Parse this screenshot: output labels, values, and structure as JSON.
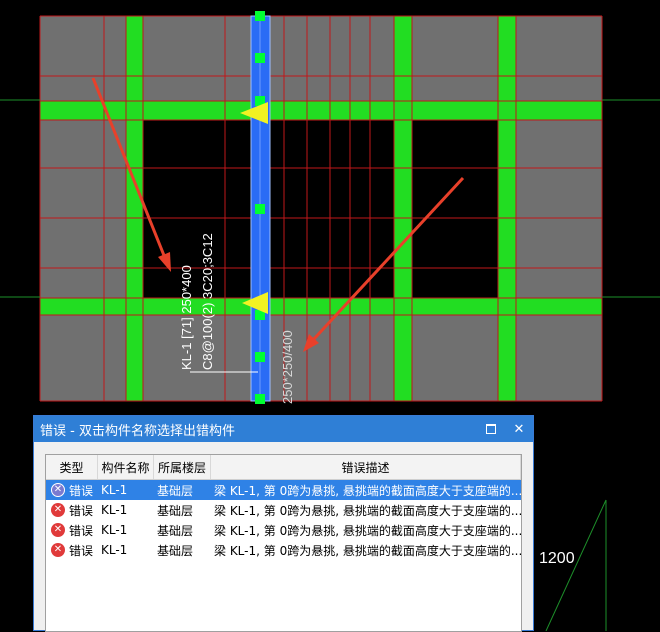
{
  "cad": {
    "beam_label_1": "KL-1 [71] 250*400",
    "beam_label_2": "C8@100(2) 3C20;3C12",
    "beam_label_3": "250*250/400",
    "dimension": "1200",
    "colors": {
      "slab": "#707070",
      "column": "#22dd22",
      "beam": "#2a6cf5",
      "grid": "#c0171a",
      "arrow": "#e8402a",
      "marker": "#f2f222"
    }
  },
  "dialog": {
    "title": "错误 - 双击构件名称选择出错构件",
    "columns": [
      "类型",
      "构件名称",
      "所属楼层",
      "错误描述"
    ],
    "rows": [
      {
        "type": "错误",
        "name": "KL-1",
        "floor": "基础层",
        "desc": "梁 KL-1, 第 0跨为悬挑, 悬挑端的截面高度大于支座端的..."
      },
      {
        "type": "错误",
        "name": "KL-1",
        "floor": "基础层",
        "desc": "梁 KL-1, 第 0跨为悬挑, 悬挑端的截面高度大于支座端的..."
      },
      {
        "type": "错误",
        "name": "KL-1",
        "floor": "基础层",
        "desc": "梁 KL-1, 第 0跨为悬挑, 悬挑端的截面高度大于支座端的..."
      },
      {
        "type": "错误",
        "name": "KL-1",
        "floor": "基础层",
        "desc": "梁 KL-1, 第 0跨为悬挑, 悬挑端的截面高度大于支座端的..."
      }
    ]
  }
}
